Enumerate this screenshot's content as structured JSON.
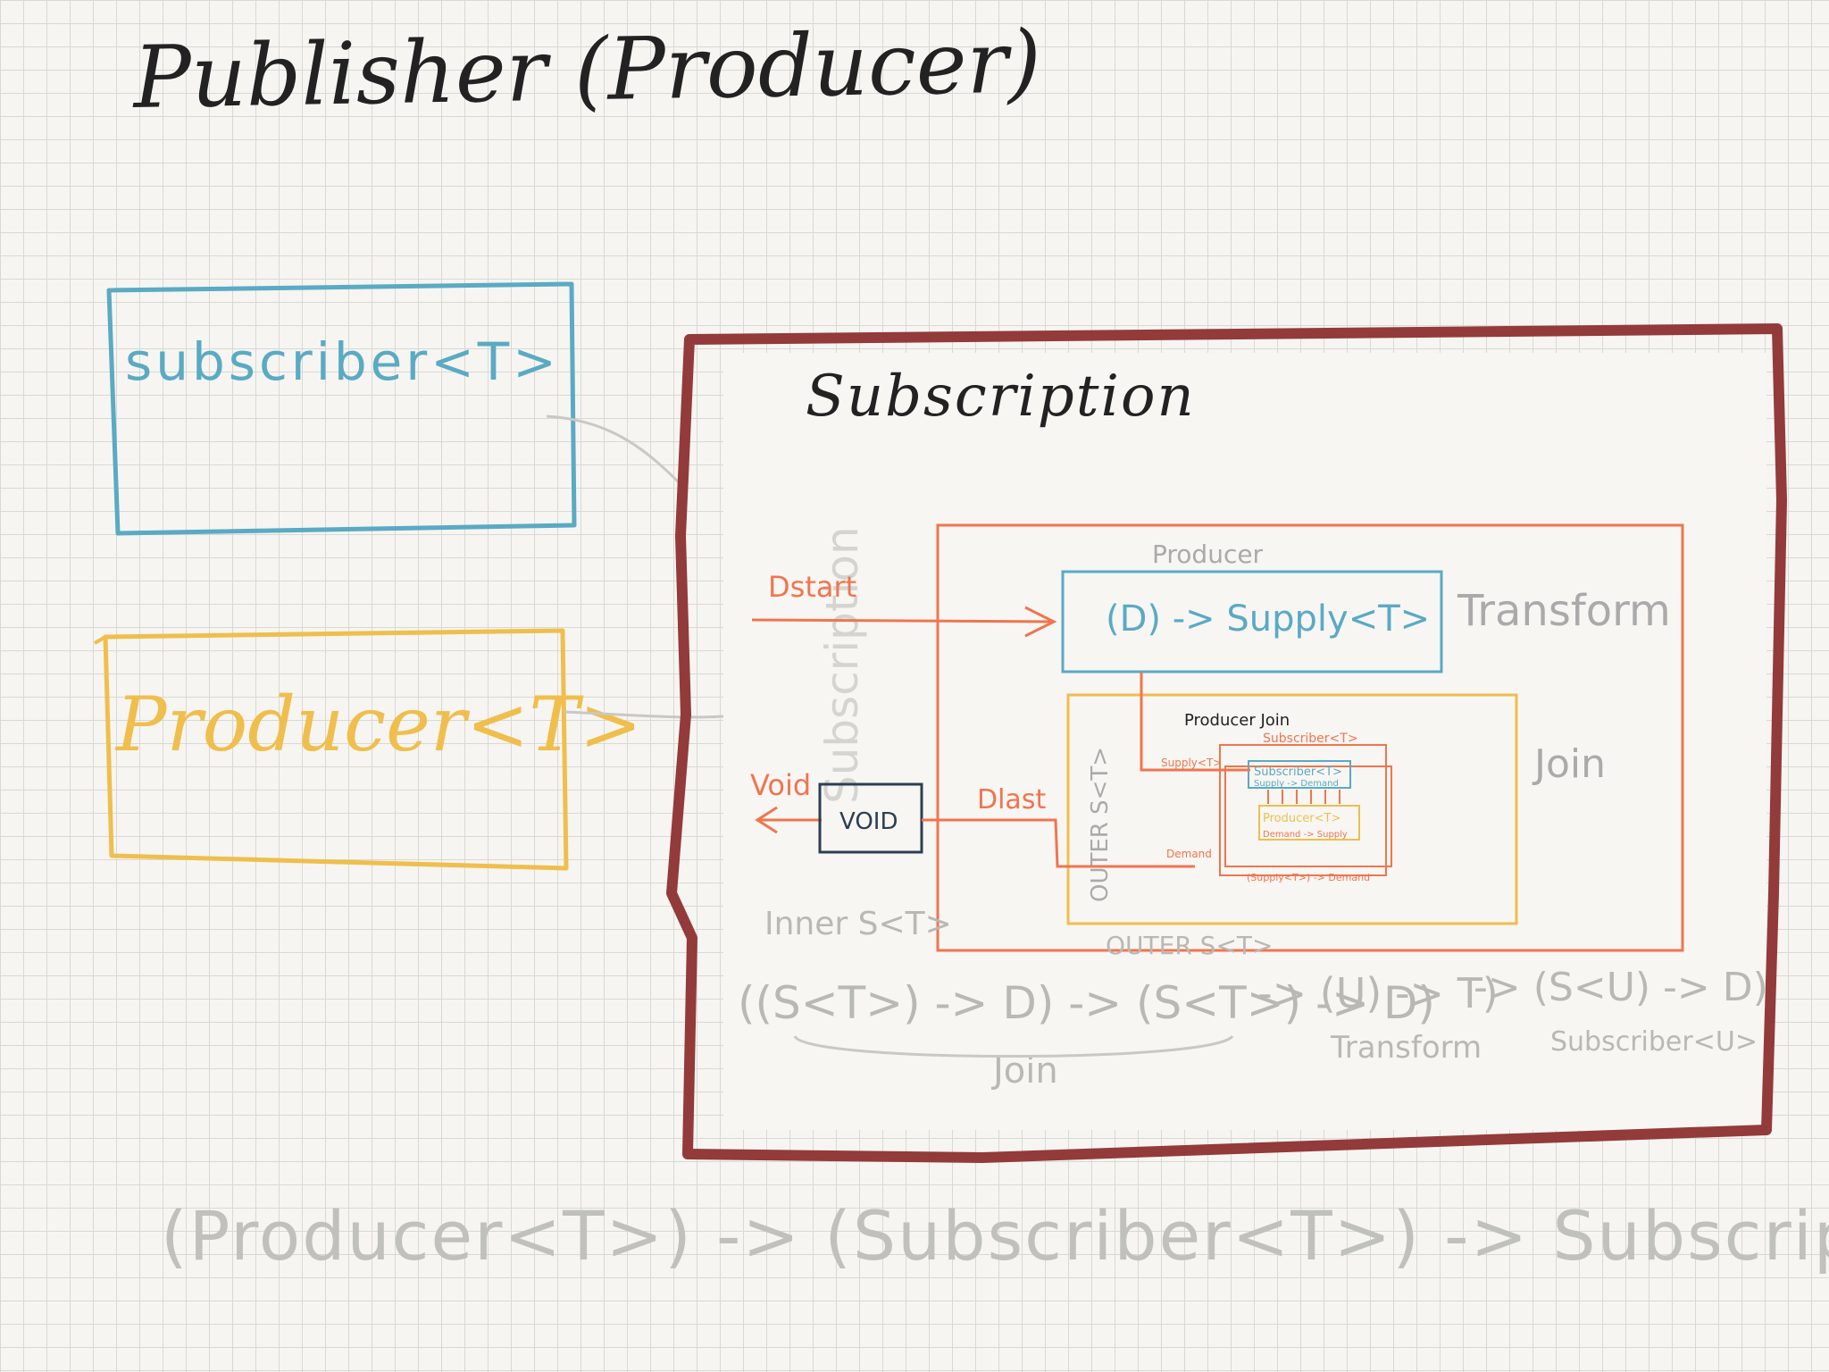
{
  "title": "Publisher (Producer)",
  "boxes": {
    "subscriber": "subscriber<T>",
    "producer": "Producer<T>",
    "subscription": "Subscription"
  },
  "subscription_inner": {
    "producer_label": "Producer",
    "transform_fn": "(D) -> Supply<T>",
    "transform_label": "Transform",
    "join_label": "Join",
    "d_start": "Dstart",
    "d_last": "Dlast",
    "void_out": "Void",
    "void_box": "VOID",
    "outer_vertical": "OUTER S<T>",
    "subscription_vertical": "Subscription",
    "producer_join": "Producer Join",
    "subscriber_t": "Subscriber<T>",
    "supply_t": "Supply<T>",
    "inner_subscriber": "Subscriber<T>",
    "inner_supply_demand": "Supply -> Demand",
    "inner_producer": "Producer<T>",
    "inner_demand_supply": "Demand -> Supply",
    "demand": "Demand",
    "supply_to_demand": "(Supply<T>) -> Demand"
  },
  "formula": {
    "inner_label": "Inner S<T>",
    "outer_label": "OUTER S<T>",
    "expr1": "((S<T>) -> D) -> (S<T>) -> D)",
    "expr2": "-> (U) -> T)",
    "expr3": "-> (S<U) -> D)",
    "join": "Join",
    "transform": "Transform",
    "subscriber_u": "Subscriber<U>"
  },
  "bottom_signature": "(Producer<T>) -> (Subscriber<T>) -> Subscription",
  "colors": {
    "ink": "#222222",
    "blue": "#5aaac4",
    "yellow": "#efbe4c",
    "darkred": "#933a3a",
    "orange": "#f0754e",
    "grey": "#b8b8b4",
    "panel": "#f7f6f3"
  }
}
